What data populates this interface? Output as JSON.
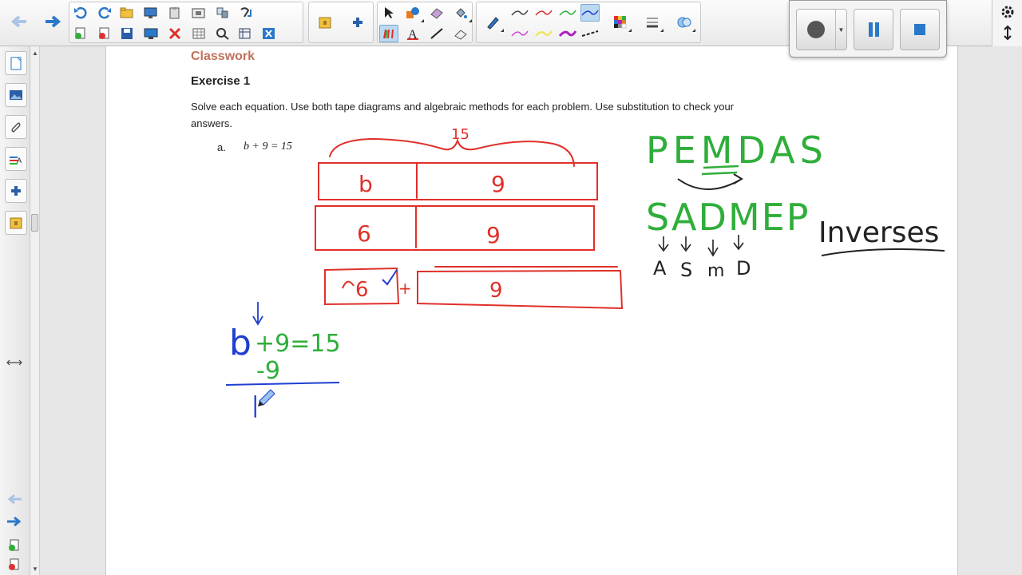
{
  "document": {
    "section_title": "Classwork",
    "exercise_title": "Exercise 1",
    "instructions": "Solve each equation.  Use both tape diagrams and algebraic methods for each problem.  Use substitution to check your",
    "instructions_line2": "answers.",
    "problem_label": "a.",
    "problem_equation": "b + 9 = 15"
  },
  "ink": {
    "total_label": "15",
    "tape1": [
      "b",
      "9"
    ],
    "tape2": [
      "6",
      "9"
    ],
    "tape3": [
      "6",
      "9"
    ],
    "plus": "+",
    "mnemonic": "PEMDAS",
    "reversed": "SADMEP",
    "ops": [
      "A",
      "S",
      "m",
      "D"
    ],
    "inverses": "Inverses",
    "eq_b": "b",
    "eq_rest": "+9=15",
    "eq_sub": "-9",
    "eq_partial": "|"
  },
  "colors": {
    "ink_red": "#e0302a",
    "ink_green": "#2fae3a",
    "ink_blue": "#1f3fd0",
    "ink_black": "#222222",
    "heading_brown": "#c0715a",
    "toolbar_blue": "#2a78c9"
  },
  "toolbar": {
    "icons": [
      "back-arrow-icon",
      "forward-arrow-icon",
      "undo-icon",
      "redo-icon",
      "open-folder-icon",
      "screen-shade-icon",
      "paste-icon",
      "screen-capture-icon",
      "page-sorter-icon",
      "attachment-icon",
      "add-page-icon",
      "delete-page-icon",
      "save-icon",
      "display-icon",
      "delete-icon",
      "table-icon",
      "properties-icon",
      "table-insert-icon",
      "close-box-icon",
      "gallery-icon",
      "addon-icon",
      "select-icon",
      "shapes-icon",
      "eraser-icon",
      "fill-icon",
      "creative-pen-icon",
      "text-icon",
      "line-icon",
      "magic-eraser-icon",
      "pen-icon",
      "color-palette-icon",
      "line-style-icon",
      "layer-icon"
    ]
  },
  "sidebar": {
    "tabs": [
      "page-sorter-tab",
      "gallery-tab",
      "attachments-tab",
      "properties-tab",
      "addons-tab",
      "lesson-activity-tab"
    ]
  },
  "recorder": {
    "buttons": [
      "record-button",
      "pause-button",
      "stop-button"
    ]
  }
}
